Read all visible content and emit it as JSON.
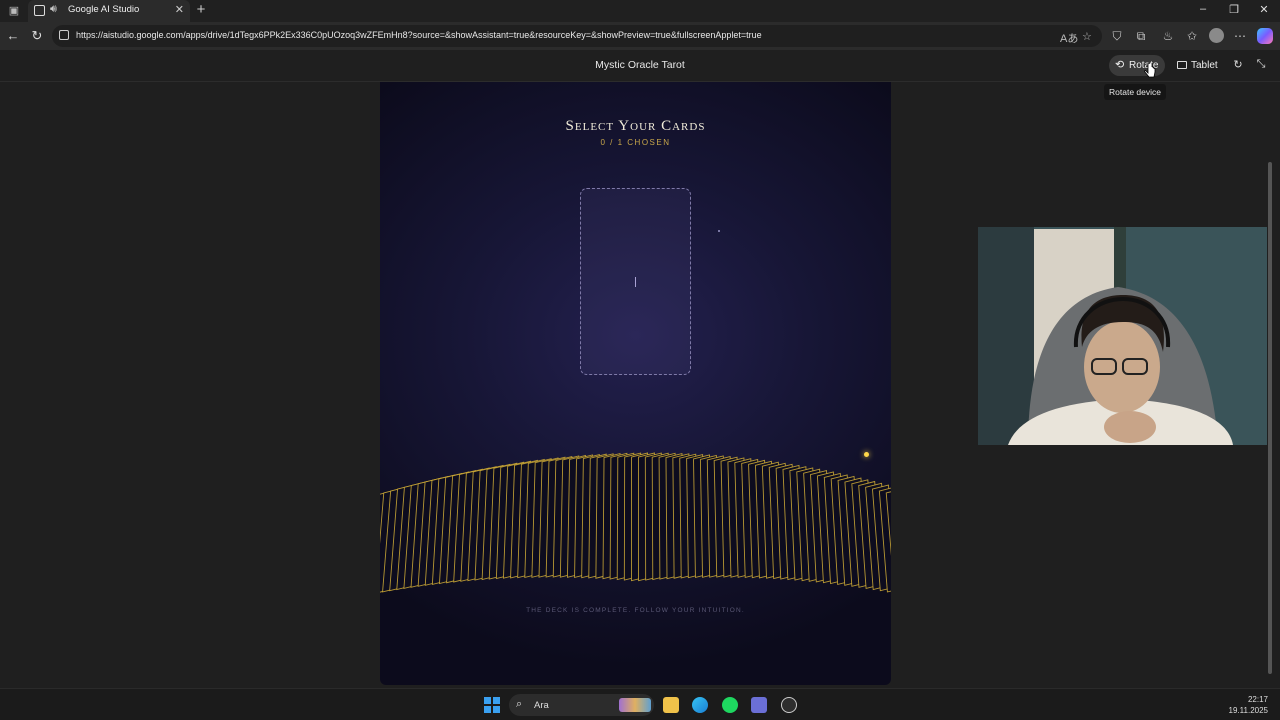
{
  "browser": {
    "tab_title": "Google AI Studio",
    "url": "https://aistudio.google.com/apps/drive/1dTegx6PPk2Ex336C0pUOzoq3wZFEmHn8?source=&showAssistant=true&resourceKey=&showPreview=true&fullscreenApplet=true"
  },
  "applet_header": {
    "title": "Mystic Oracle Tarot",
    "rotate_label": "Rotate",
    "tablet_label": "Tablet",
    "tooltip": "Rotate device"
  },
  "applet": {
    "heading": "Select Your Cards",
    "chosen_count": "0 / 1 CHOSEN",
    "footer_message": "THE DECK IS COMPLETE. FOLLOW YOUR INTUITION.",
    "accent_color": "#d4af37",
    "background_color": "#161533"
  },
  "taskbar": {
    "search_label": "Ara",
    "time": "22:17",
    "date": "19.11.2025"
  }
}
